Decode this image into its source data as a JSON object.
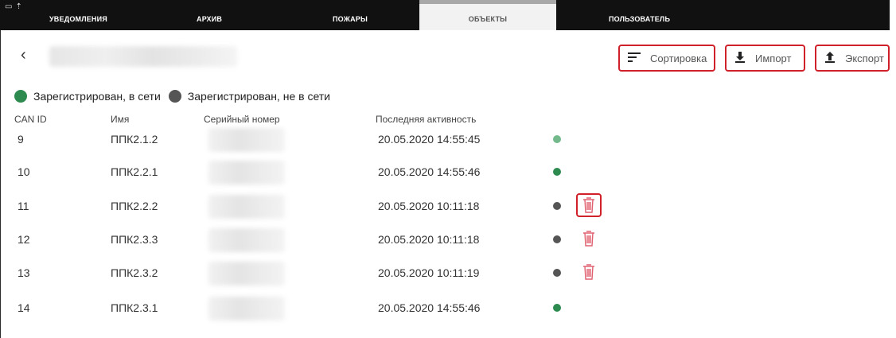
{
  "colors": {
    "accent_red": "#d0202a",
    "online_green": "#2e8b4f",
    "offline_gray": "#555555",
    "tabbar_bg": "#111111"
  },
  "tabs": [
    {
      "label": "УВЕДОМЛЕНИЯ",
      "active": false
    },
    {
      "label": "АРХИВ",
      "active": false
    },
    {
      "label": "ПОЖАРЫ",
      "active": false
    },
    {
      "label": "ОБЪЕКТЫ",
      "active": true
    },
    {
      "label": "ПОЛЬЗОВАТЕЛЬ",
      "active": false
    }
  ],
  "header": {
    "back_icon": "chevron-left-icon",
    "back_glyph": "‹",
    "sort_label": "Сортировка",
    "import_label": "Импорт",
    "export_label": "Экспорт"
  },
  "legend": {
    "online": "Зарегистрирован, в сети",
    "offline": "Зарегистрирован, не в сети"
  },
  "table": {
    "columns": [
      "CAN ID",
      "Имя",
      "Серийный номер",
      "Последняя активность"
    ],
    "rows": [
      {
        "can_id": "9",
        "name": "ППК2.1.2",
        "activity": "20.05.2020 14:55:45",
        "status": "online",
        "deletable": false,
        "highlighted": false
      },
      {
        "can_id": "10",
        "name": "ППК2.2.1",
        "activity": "20.05.2020 14:55:46",
        "status": "online",
        "deletable": false,
        "highlighted": false
      },
      {
        "can_id": "11",
        "name": "ППК2.2.2",
        "activity": "20.05.2020 10:11:18",
        "status": "offline",
        "deletable": true,
        "highlighted": true
      },
      {
        "can_id": "12",
        "name": "ППК2.3.3",
        "activity": "20.05.2020 10:11:18",
        "status": "offline",
        "deletable": true,
        "highlighted": false
      },
      {
        "can_id": "13",
        "name": "ППК2.3.2",
        "activity": "20.05.2020 10:11:19",
        "status": "offline",
        "deletable": true,
        "highlighted": false
      },
      {
        "can_id": "14",
        "name": "ППК2.3.1",
        "activity": "20.05.2020 14:55:46",
        "status": "online",
        "deletable": false,
        "highlighted": false
      }
    ]
  }
}
